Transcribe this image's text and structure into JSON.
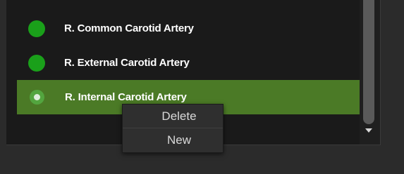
{
  "artery_list": {
    "items": [
      {
        "label": "R. Common Carotid Artery",
        "status_color": "#1aa01a",
        "selected": false
      },
      {
        "label": "R. External Carotid Artery",
        "status_color": "#1aa01a",
        "selected": false
      },
      {
        "label": "R. Internal Carotid Artery",
        "status_color": "#53a53f",
        "selected": true
      }
    ],
    "selected_row_color": "#4b7a26"
  },
  "context_menu": {
    "delete_label": "Delete",
    "new_label": "New"
  },
  "icons": {
    "status": "circle-status-icon",
    "scroll_down": "triangle-down-icon"
  }
}
